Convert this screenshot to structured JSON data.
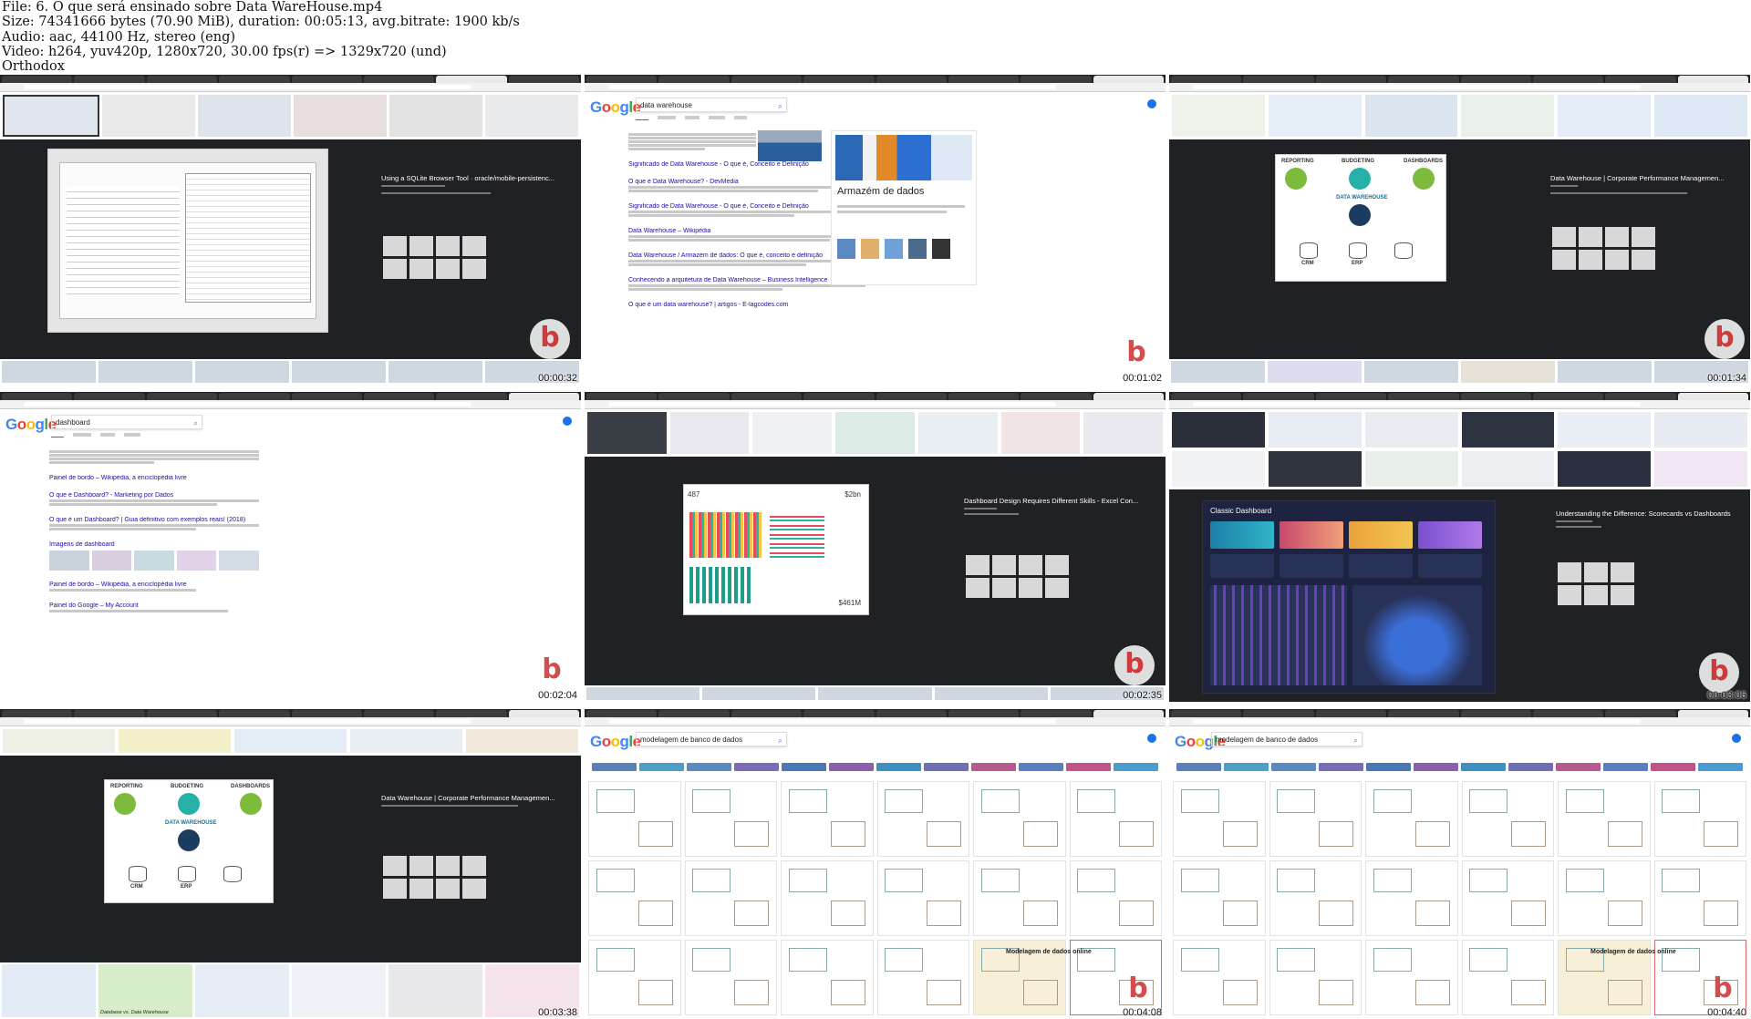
{
  "header": {
    "file_line": "File: 6. O que será ensinado sobre Data WareHouse.mp4",
    "size_line": "Size: 74341666 bytes (70.90 MiB), duration: 00:05:13, avg.bitrate: 1900 kb/s",
    "audio_line": "Audio: aac, 44100 Hz, stereo (eng)",
    "video_line": "Video: h264, yuv420p, 1280x720, 30.00 fps(r) => 1329x720 (und)",
    "brand_line": "Orthodox"
  },
  "frames": [
    {
      "timestamp": "00:00:32",
      "panel_title": "Using a SQLite Browser Tool · oracle/mobile-persistenc...",
      "watermark": "b"
    },
    {
      "timestamp": "00:01:02",
      "search_query": "data warehouse",
      "results": [
        "Significado de Data Warehouse - O que é, Conceito e Definição",
        "O que é Data Warehouse? - DevMedia",
        "Significado de Data Warehouse - O que é, Conceito e Definição",
        "Data Warehouse – Wikipédia",
        "Data Warehouse / Armazém de dados: O que é, conceito e definição",
        "Conhecendo a arquitetura de Data Warehouse – Business Intelligence",
        "O que é um data warehouse? | artigos - E-lagcodes.com"
      ],
      "knowledge_title": "Armazém de dados",
      "watermark": "b"
    },
    {
      "timestamp": "00:01:34",
      "panel_title": "Data Warehouse | Corporate Performance Managemen...",
      "dw_labels": [
        "REPORTING",
        "BUDGETING",
        "DASHBOARDS",
        "DATA WAREHOUSE",
        "CRM",
        "ERP"
      ],
      "watermark": "b"
    },
    {
      "timestamp": "00:02:04",
      "search_query": "dashboard",
      "results": [
        "Painel de bordo – Wikipédia, a enciclopédia livre",
        "O que é Dashboard? - Marketing por Dados",
        "O que é um Dashboard? | Guia definitivo com exemplos reais! (2018)",
        "Imagens de dashboard",
        "Painel de bordo – Wikipédia, a enciclopédia livre",
        "Painel do Google – My Account"
      ],
      "watermark": "b"
    },
    {
      "timestamp": "00:02:35",
      "panel_title": "Dashboard Design Requires Different Skills - Excel Con...",
      "metrics": [
        "487",
        "$2bn",
        "$461M"
      ],
      "watermark": "b"
    },
    {
      "timestamp": "00:03:06",
      "panel_title": "Understanding the Difference: Scorecards vs Dashboards",
      "dashboard_title": "Classic Dashboard",
      "watermark": "b"
    },
    {
      "timestamp": "00:03:38",
      "panel_title": "Data Warehouse | Corporate Performance Managemen...",
      "dw_labels": [
        "REPORTING",
        "BUDGETING",
        "DASHBOARDS",
        "DATA WAREHOUSE",
        "CRM",
        "ERP"
      ],
      "bottom_caption": "Database vs. Data Warehouse",
      "watermark": "b"
    },
    {
      "timestamp": "00:04:08",
      "search_query": "modelagem de banco de dados",
      "caption": "Modelagem de dados online",
      "watermark": "b"
    },
    {
      "timestamp": "00:04:40",
      "search_query": "modelagem de banco de dados",
      "caption": "Modelagem de dados online",
      "watermark": "b"
    }
  ],
  "google_logo": [
    "G",
    "o",
    "o",
    "g",
    "l",
    "e"
  ],
  "colors": {
    "dark_panel": "#202124",
    "link": "#1a0dab",
    "url": "#006621",
    "watermark_red": "#d34d4d"
  }
}
